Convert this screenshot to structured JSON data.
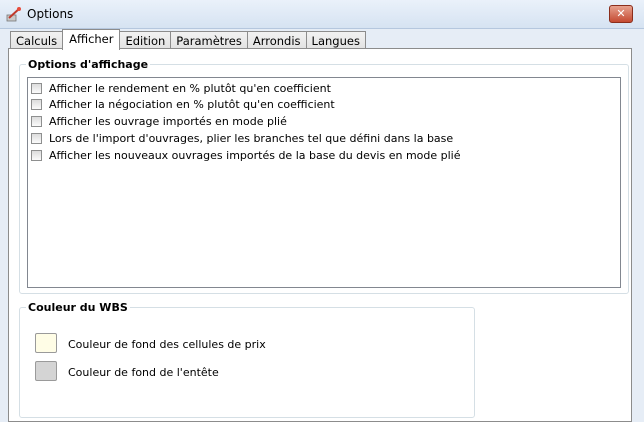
{
  "window": {
    "title": "Options",
    "close_label": "✕"
  },
  "tabs": [
    {
      "label": "Calculs"
    },
    {
      "label": "Afficher"
    },
    {
      "label": "Edition"
    },
    {
      "label": "Paramètres"
    },
    {
      "label": "Arrondis"
    },
    {
      "label": "Langues"
    }
  ],
  "display_options": {
    "title": "Options d'affichage",
    "items": [
      {
        "label": "Afficher le rendement en % plutôt qu'en coefficient",
        "checked": false
      },
      {
        "label": "Afficher la négociation en % plutôt qu'en coefficient",
        "checked": false
      },
      {
        "label": "Afficher les ouvrage importés en mode plié",
        "checked": false
      },
      {
        "label": "Lors de l'import d'ouvrages, plier les branches tel que défini dans la base",
        "checked": false
      },
      {
        "label": "Afficher les nouveaux ouvrages importés de la base du devis en mode plié",
        "checked": false
      }
    ]
  },
  "wbs_colors": {
    "title": "Couleur du WBS",
    "items": [
      {
        "label": "Couleur de fond des cellules de prix",
        "color": "#fffde6"
      },
      {
        "label": "Couleur de fond de l'entête",
        "color": "#d4d4d4"
      }
    ]
  }
}
